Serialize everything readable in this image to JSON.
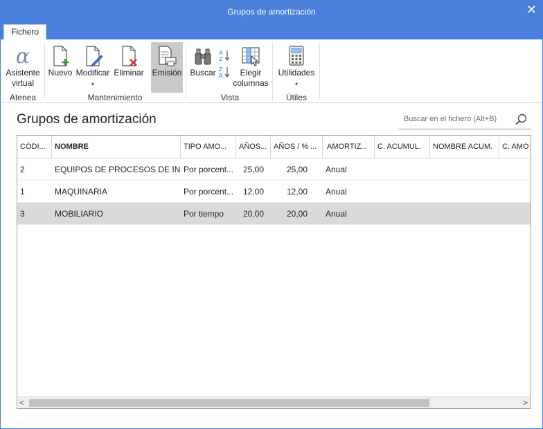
{
  "window": {
    "title": "Grupos de amortización",
    "close_glyph": "✕"
  },
  "tabs": [
    {
      "label": "Fichero"
    }
  ],
  "ribbon": {
    "buttons": {
      "asistente": "Asistente virtual",
      "nuevo": "Nuevo",
      "modificar": "Modificar",
      "eliminar": "Eliminar",
      "emision": "Emisión",
      "buscar": "Buscar",
      "elegir": "Elegir columnas",
      "utilidades": "Utilidades"
    },
    "groups": {
      "atenea": "Atenea",
      "mantenimiento": "Mantenimiento",
      "vista": "Vista",
      "utiles": "Útiles"
    },
    "dropdown_arrow": "▾"
  },
  "page": {
    "title": "Grupos de amortización"
  },
  "search": {
    "placeholder": "Buscar en el fichero (Alt+B)"
  },
  "table": {
    "columns": [
      {
        "label": "CÓDI..."
      },
      {
        "label": "NOMBRE"
      },
      {
        "label": "TIPO AMO..."
      },
      {
        "label": "AÑOS..."
      },
      {
        "label": "AÑOS / % ..."
      },
      {
        "label": "AMORTIZ..."
      },
      {
        "label": "C. ACUMUL."
      },
      {
        "label": "NOMBRE ACUM."
      },
      {
        "label": "C. AMO"
      }
    ],
    "rows": [
      {
        "codigo": "2",
        "nombre": "EQUIPOS DE PROCESOS DE INF...",
        "tipo": "Por porcent...",
        "anos": "25,00",
        "anos_pct": "25,00",
        "amortiz": "Anual"
      },
      {
        "codigo": "1",
        "nombre": "MAQUINARIA",
        "tipo": "Por porcent...",
        "anos": "12,00",
        "anos_pct": "12,00",
        "amortiz": "Anual"
      },
      {
        "codigo": "3",
        "nombre": "MOBILIARIO",
        "tipo": "Por tiempo",
        "anos": "20,00",
        "anos_pct": "20,00",
        "amortiz": "Anual"
      }
    ],
    "selected_row": 2,
    "scroll_left": "<",
    "scroll_right": ">"
  },
  "colors": {
    "accent": "#4a7fdc",
    "selected_row": "#dadada"
  }
}
